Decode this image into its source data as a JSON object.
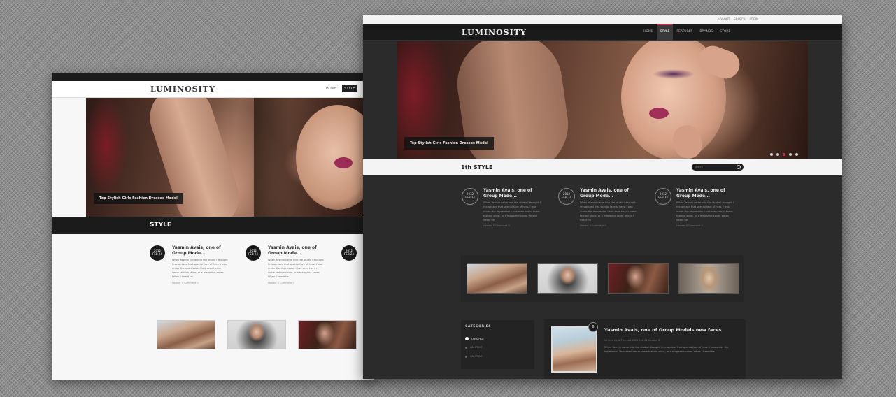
{
  "light": {
    "logo": "LUMINOSITY",
    "nav": [
      "HOME",
      "STYLE"
    ],
    "hero_caption": "Top Stylish Girls Fashion Dresses Model",
    "section_title": "STYLE",
    "posts": [
      {
        "date1": "2012",
        "date2": "FEB 24",
        "title": "Yasmin Avais, one of Group Mode...",
        "excerpt": "When Yasmin came into the studio I thought I recognized that special face of hers. I was under the impression I had seen her in some fashion show, or a magazine cover. When I heard he",
        "meta": "Header  0    Comment  0"
      },
      {
        "date1": "2012",
        "date2": "FEB 24",
        "title": "Yasmin Avais, one of Group Mode...",
        "excerpt": "When Yasmin came into the studio I thought I recognized that special face of hers. I was under the impression I had seen her in some fashion show, or a magazine cover. When I heard he",
        "meta": "Header  0    Comment  0"
      },
      {
        "date1": "2012",
        "date2": "FEB 24",
        "title": "",
        "excerpt": "",
        "meta": ""
      }
    ]
  },
  "dark": {
    "top_links": [
      "LOGOUT",
      "SEARCH",
      "LOGIN"
    ],
    "logo": "LUMINOSITY",
    "nav": [
      "HOME",
      "STYLE",
      "FEATURES",
      "BRANDS",
      "STORE"
    ],
    "hero_caption": "Top Stylish Girls Fashion Dresses Model",
    "section_title": "1th STYLE",
    "search_placeholder": "search",
    "posts": [
      {
        "date1": "2012",
        "date2": "FEB 24",
        "title": "Yasmin Avais, one of Group Mode...",
        "excerpt": "When Yasmin came into the studio I thought I recognized that special face of hers. I was under the impression I had seen her in some fashion show, or a magazine cover. When I heard he",
        "meta": "Header  0    Comment  0"
      },
      {
        "date1": "2012",
        "date2": "FEB 24",
        "title": "Yasmin Avais, one of Group Mode...",
        "excerpt": "When Yasmin came into the studio I thought I recognized that special face of hers. I was under the impression I had seen her in some fashion show, or a magazine cover. When I heard he",
        "meta": "Header  0    Comment  0"
      },
      {
        "date1": "2012",
        "date2": "FEB 24",
        "title": "Yasmin Avais, one of Group Mode...",
        "excerpt": "When Yasmin came into the studio I thought I recognized that special face of hers. I was under the impression I had seen her in some fashion show, or a magazine cover. When I heard he",
        "meta": "Header  0    Comment  0"
      }
    ],
    "categories": {
      "heading": "CATEGORIES",
      "items": [
        "ON STYLE",
        "ON STYLE",
        "ON STYLE"
      ]
    },
    "feature": {
      "badge": "6",
      "title": "Yasmin Avais, one of Group Models new faces",
      "meta": "Written by ArThemes    2012 Feb 24    Header 0",
      "excerpt": "When Yasmin came into the studio I thought I recognized that special face of hers. I was under the impression I had seen her in some fashion show, or a magazine cover. When I heard he"
    }
  },
  "colors": {
    "accent": "#c0304a",
    "dark_bg": "#2b2b2b",
    "header_bg": "#1a1a1a"
  }
}
